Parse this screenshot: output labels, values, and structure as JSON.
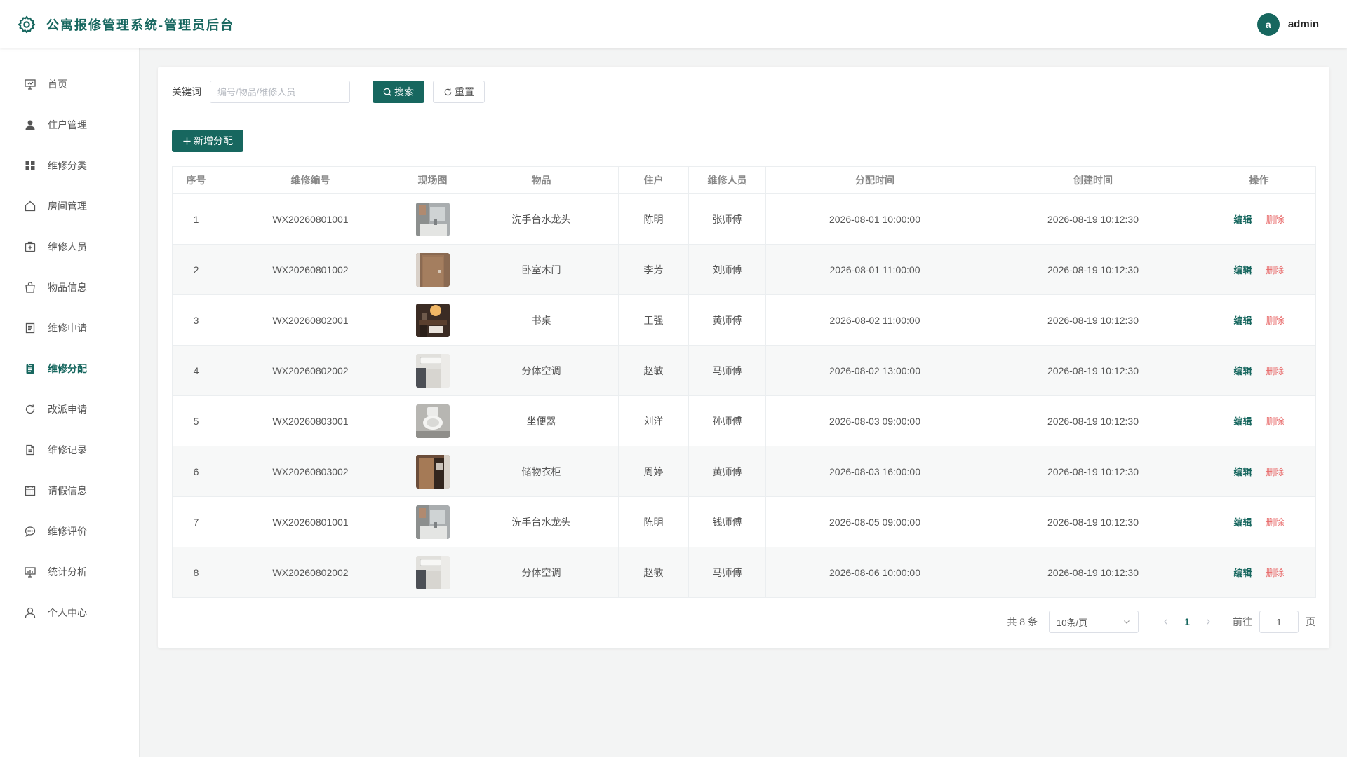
{
  "header": {
    "title": "公寓报修管理系统-管理员后台",
    "avatar_letter": "a",
    "username": "admin",
    "accent": "#17675f"
  },
  "sidebar": {
    "items": [
      {
        "label": "首页",
        "icon": "presentation-board-icon",
        "active": false
      },
      {
        "label": "住户管理",
        "icon": "user-icon",
        "active": false
      },
      {
        "label": "维修分类",
        "icon": "grid-icon",
        "active": false
      },
      {
        "label": "房间管理",
        "icon": "home-icon",
        "active": false
      },
      {
        "label": "维修人员",
        "icon": "first-aid-kit-icon",
        "active": false
      },
      {
        "label": "物品信息",
        "icon": "shopping-bag-icon",
        "active": false
      },
      {
        "label": "维修申请",
        "icon": "document-icon",
        "active": false
      },
      {
        "label": "维修分配",
        "icon": "clipboard-icon",
        "active": true
      },
      {
        "label": "改派申请",
        "icon": "refresh-icon",
        "active": false
      },
      {
        "label": "维修记录",
        "icon": "file-text-icon",
        "active": false
      },
      {
        "label": "请假信息",
        "icon": "calendar-icon",
        "active": false
      },
      {
        "label": "维修评价",
        "icon": "chat-bubble-icon",
        "active": false
      },
      {
        "label": "统计分析",
        "icon": "data-board-icon",
        "active": false
      },
      {
        "label": "个人中心",
        "icon": "user-outline-icon",
        "active": false
      }
    ]
  },
  "search": {
    "label": "关键词",
    "placeholder": "编号/物品/维修人员",
    "value": "",
    "search_button": "搜索",
    "reset_button": "重置"
  },
  "toolbar": {
    "add_button": "新增分配"
  },
  "table": {
    "columns": [
      "序号",
      "维修编号",
      "现场图",
      "物品",
      "住户",
      "维修人员",
      "分配时间",
      "创建时间",
      "操作"
    ],
    "edit_label": "编辑",
    "delete_label": "删除",
    "rows": [
      {
        "no": "1",
        "code": "WX20260801001",
        "photo": "bathroom-faucet-photo",
        "item": "洗手台水龙头",
        "resident": "陈明",
        "worker": "张师傅",
        "assigned": "2026-08-01 10:00:00",
        "created": "2026-08-19 10:12:30"
      },
      {
        "no": "2",
        "code": "WX20260801002",
        "photo": "wooden-door-photo",
        "item": "卧室木门",
        "resident": "李芳",
        "worker": "刘师傅",
        "assigned": "2026-08-01 11:00:00",
        "created": "2026-08-19 10:12:30"
      },
      {
        "no": "3",
        "code": "WX20260802001",
        "photo": "desk-photo",
        "item": "书桌",
        "resident": "王强",
        "worker": "黄师傅",
        "assigned": "2026-08-02 11:00:00",
        "created": "2026-08-19 10:12:30"
      },
      {
        "no": "4",
        "code": "WX20260802002",
        "photo": "air-conditioner-photo",
        "item": "分体空调",
        "resident": "赵敏",
        "worker": "马师傅",
        "assigned": "2026-08-02 13:00:00",
        "created": "2026-08-19 10:12:30"
      },
      {
        "no": "5",
        "code": "WX20260803001",
        "photo": "toilet-photo",
        "item": "坐便器",
        "resident": "刘洋",
        "worker": "孙师傅",
        "assigned": "2026-08-03 09:00:00",
        "created": "2026-08-19 10:12:30"
      },
      {
        "no": "6",
        "code": "WX20260803002",
        "photo": "wardrobe-photo",
        "item": "储物衣柜",
        "resident": "周婷",
        "worker": "黄师傅",
        "assigned": "2026-08-03 16:00:00",
        "created": "2026-08-19 10:12:30"
      },
      {
        "no": "7",
        "code": "WX20260801001",
        "photo": "bathroom-faucet-photo",
        "item": "洗手台水龙头",
        "resident": "陈明",
        "worker": "钱师傅",
        "assigned": "2026-08-05 09:00:00",
        "created": "2026-08-19 10:12:30"
      },
      {
        "no": "8",
        "code": "WX20260802002",
        "photo": "air-conditioner-photo",
        "item": "分体空调",
        "resident": "赵敏",
        "worker": "马师傅",
        "assigned": "2026-08-06 10:00:00",
        "created": "2026-08-19 10:12:30"
      }
    ]
  },
  "pagination": {
    "total_text": "共 8 条",
    "page_size": "10条/页",
    "current_page": "1",
    "goto_label": "前往",
    "goto_value": "1",
    "goto_suffix": "页"
  }
}
